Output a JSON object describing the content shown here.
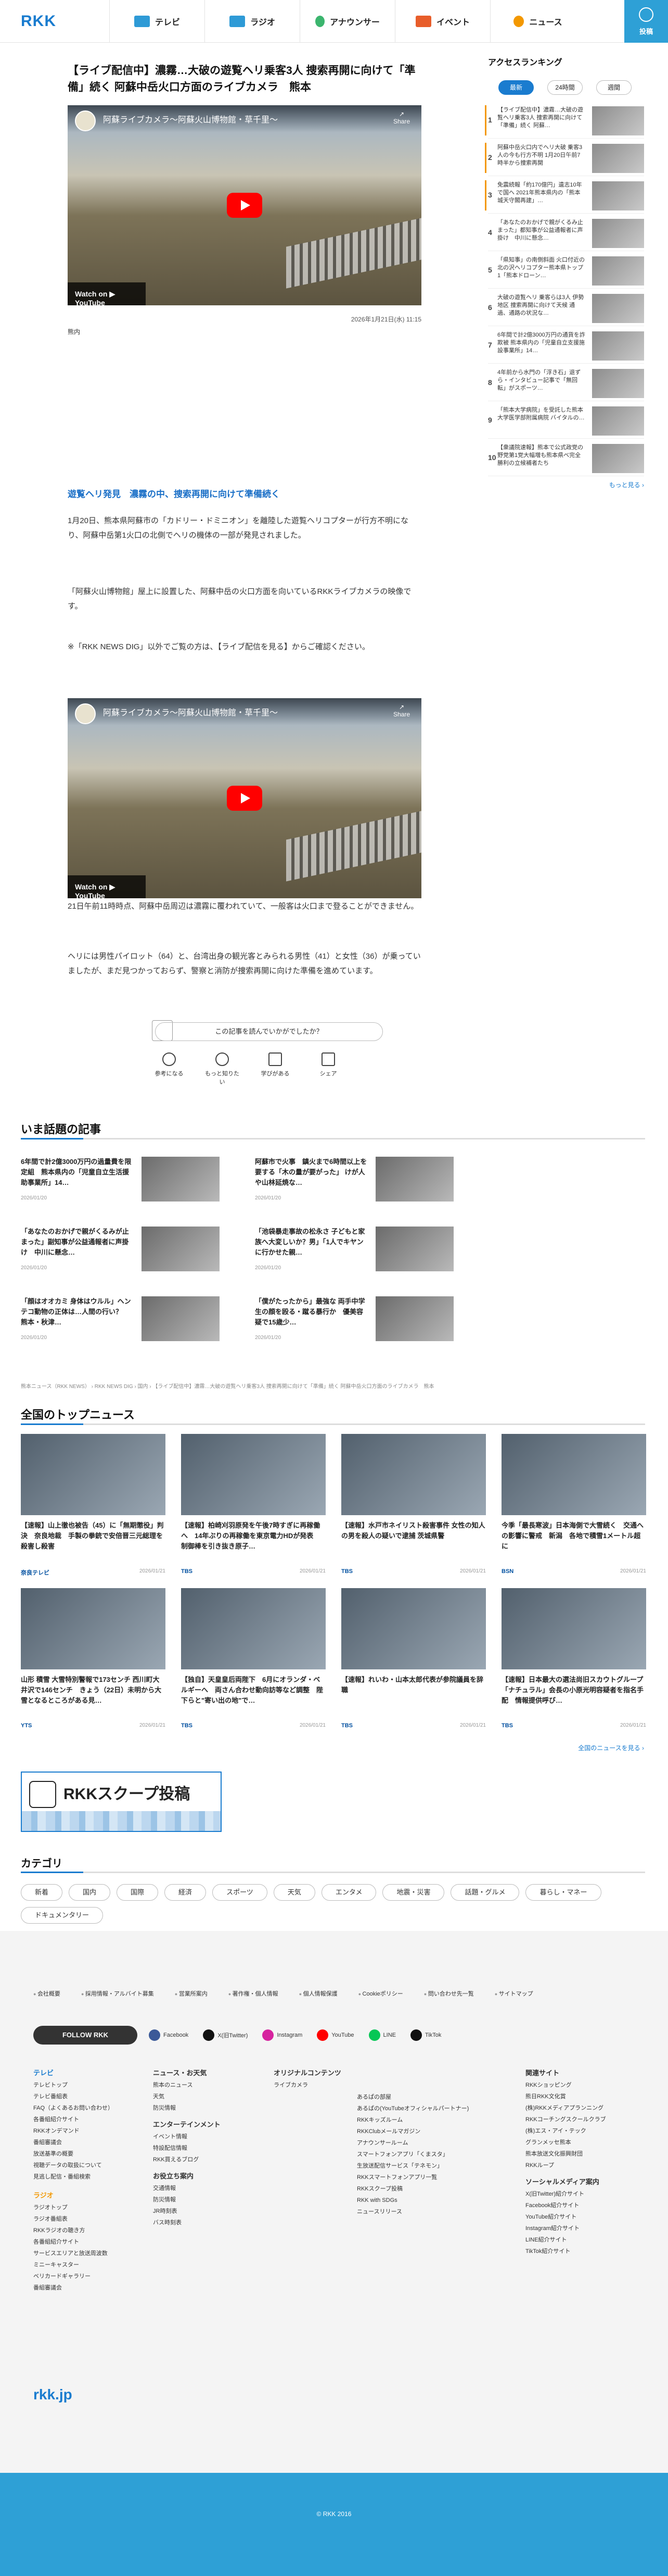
{
  "header": {
    "logo": "RKK",
    "nav": [
      {
        "label": "テレビ",
        "color": "#2e9ad6"
      },
      {
        "label": "ラジオ",
        "color": "#2e9ad6"
      },
      {
        "label": "アナウンサー",
        "color": "#3bb56e"
      },
      {
        "label": "イベント",
        "color": "#e85d2a"
      },
      {
        "label": "ニュース",
        "color": "#f39800"
      }
    ],
    "post": "投稿"
  },
  "article": {
    "title": "【ライブ配信中】濃霧…大破の遊覧ヘリ乗客3人 捜索再開に向けて「準備」続く 阿蘇中岳火口方面のライブカメラ　熊本",
    "video_title": "阿蘇ライブカメラ〜阿蘇火山博物館・草千里〜",
    "share": "Share",
    "watch": "Watch on ▶ YouTube",
    "date": "2026年1月21日(水) 11:15",
    "caption": "熊内",
    "subhead": "遊覧ヘリ発見　濃霧の中、捜索再開に向けて準備続く",
    "p1": "1月20日、熊本県阿蘇市の「カドリー・ドミニオン」を離陸した遊覧ヘリコプターが行方不明になり、阿蘇中岳第1火口の北側でヘリの機体の一部が発見されました。",
    "p2": "「阿蘇火山博物館」屋上に設置した、阿蘇中岳の火口方面を向いているRKKライブカメラの映像です。",
    "p3": "※「RKK NEWS DIG」以外でご覧の方は、【ライブ配信を見る】からご確認ください。",
    "p4": "21日午前11時時点、阿蘇中岳周辺は濃霧に覆われていて、一般客は火口まで登ることができません。",
    "p5": "ヘリには男性パイロット（64）と、台湾出身の観光客とみられる男性（41）と女性（36）が乗っていましたが、まだ見つかっておらず、警察と消防が捜索再開に向けた準備を進めています。",
    "survey": "この記事を読んでいかがでしたか？",
    "reactions": [
      "参考になる",
      "もっと知りたい",
      "学びがある",
      "シェア"
    ]
  },
  "ranking": {
    "title": "アクセスランキング",
    "tabs": [
      "最新",
      "24時間",
      "週間"
    ],
    "items": [
      {
        "n": "1",
        "t": "【ライブ配信中】濃霧…大破の遊覧ヘリ乗客3人 捜索再開に向けて「準備」続く 阿蘇…"
      },
      {
        "n": "2",
        "t": "阿蘇中岳火口内でヘリ大破 乗客3人の今も行方不明 1月20日午前7時半から捜索再開"
      },
      {
        "n": "3",
        "t": "免震続報「約170億円」遺志10年で国へ 2021年熊本県内の「熊本城天守閣再建」…"
      },
      {
        "n": "4",
        "t": "「あなたのおかげで親がくるみ止まった」都知事が公益通報者に声掛け　中川に懸念…"
      },
      {
        "n": "5",
        "t": "「県知事」の南側斜面 火口付近の北の沢ヘリコプター熊本県トップ1「熊本ドローン…"
      },
      {
        "n": "6",
        "t": "大破の遊覧ヘリ 乗客らは3人 伊勢地区 捜索再開に向けて天候 通過、通路の状況な…"
      },
      {
        "n": "7",
        "t": "6年間で計2億3000万円の通貨を詐欺被 熊本県内の「児童自立支援施設事業所」14…"
      },
      {
        "n": "8",
        "t": "4年前から水門の「浮き石」退ずら・インタビュー記事で「無回転」がスポーツ…"
      },
      {
        "n": "9",
        "t": "「熊本大学病院」を受託した熊本大学医学部附属病院 バイタルの…"
      },
      {
        "n": "10",
        "t": "【衆議院速報】熊本で公式政党の野党第1党大幅増も熊本県ベ完全勝利の立候補者たち"
      }
    ],
    "more": "もっと見る ›"
  },
  "topics": {
    "title": "いま話題の記事",
    "items": [
      {
        "t": "6年間で計2億3000万円の過量費を限定組　熊本県内の「児童自立生活援助事業所」14…",
        "d": "2026/01/20"
      },
      {
        "t": "阿蘇市で火事　鎮火まで6時間以上を要する「木の量が要がった」 けが人や山林延焼な…",
        "d": "2026/01/20"
      },
      {
        "t": "「あなたのおかげで親がくるみが止まった」副知事が公益通報者に声掛け　中川に懸念…",
        "d": "2026/01/20"
      },
      {
        "t": "「池袋暴走事故の松永さ 子どもと家族へ大変しいか？男」「1人でキヤンに行かせた親…",
        "d": "2026/01/20"
      },
      {
        "t": "「顔はオオカミ 身体はウルル」ヘンテコ動物の正体は…人間の行い？　熊本・秋津…",
        "d": "2026/01/20"
      },
      {
        "t": "「僕がたったから」最強な 両手中学生の顔を殴る・蹴る暴行か　優美容疑で15歳少…",
        "d": "2026/01/20"
      }
    ]
  },
  "crumb": "熊本ニュース（RKK NEWS） › RKK NEWS DIG › 国内 › 【ライブ配信中】濃霧…大破の遊覧ヘリ乗客3人 捜索再開に向けて「準備」続く 阿蘇中岳火口方面のライブカメラ　熊本",
  "top_news": {
    "title": "全国のトップニュース",
    "more": "全国のニュースを見る ›",
    "items": [
      {
        "t": "【速報】山上徹也被告（45）に「無期懲役」判決　奈良地裁　手製の拳銃で安倍晋三元総理を殺害し殺害",
        "s": "奈良テレビ",
        "tm": "2026/01/21"
      },
      {
        "t": "【速報】柏崎刈羽原発を午後7時すぎに再稼働へ　14年ぶりの再稼働を東京電力HDが発表　制御棒を引き抜き原子…",
        "s": "TBS",
        "tm": "2026/01/21"
      },
      {
        "t": "【速報】水戸市ネイリスト殺害事件 女性の知人の男を殺人の疑いで逮捕 茨城県警",
        "s": "TBS",
        "tm": "2026/01/21"
      },
      {
        "t": "今季「最長寒波」日本海側で大雪続く　交通への影響に警戒　新潟　各地で積雪1メートル超に",
        "s": "BSN",
        "tm": "2026/01/21"
      },
      {
        "t": "山形 積雪 大雪特別警報で173センチ 西川町大井沢で146センチ　きょう（22日）未明から大雪となるところがある見…",
        "s": "YTS",
        "tm": "2026/01/21"
      },
      {
        "t": "【独自】天皇皇后両陛下　6月にオランダ・ベルギーへ　両さん合わせ動向訪等など調整　陛下らと\"寄い出の地\"で…",
        "s": "TBS",
        "tm": "2026/01/21"
      },
      {
        "t": "【速報】れいわ・山本太郎代表が参院議員を辞職",
        "s": "TBS",
        "tm": "2026/01/21"
      },
      {
        "t": "【速報】日本最大の選法尚旧スカウトグループ「ナチュラル」会長の小原光明容疑者を指名手配　情報提供呼び…",
        "s": "TBS",
        "tm": "2026/01/21"
      }
    ]
  },
  "scoop": "RKKスクープ投稿",
  "categories": {
    "title": "カテゴリ",
    "items": [
      "新着",
      "国内",
      "国際",
      "経済",
      "スポーツ",
      "天気",
      "エンタメ",
      "地震・災害",
      "話題・グルメ",
      "暮らし・マネー",
      "ドキュメンタリー"
    ]
  },
  "footer": {
    "links": [
      "会社概要",
      "採用情報・アルバイト募集",
      "営業所案内",
      "著作権・個人情報",
      "個人情報保護",
      "Cookieポリシー",
      "問い合わせ先一覧",
      "サイトマップ"
    ],
    "follow": "FOLLOW RKK",
    "sns": [
      {
        "l": "Facebook",
        "c": "#3b5998"
      },
      {
        "l": "X(旧Twitter)",
        "c": "#111"
      },
      {
        "l": "Instagram",
        "c": "#d6249f"
      },
      {
        "l": "YouTube",
        "c": "#ff0000"
      },
      {
        "l": "LINE",
        "c": "#06c755"
      },
      {
        "l": "TikTok",
        "c": "#111"
      }
    ],
    "col1": {
      "h": "テレビ",
      "items": [
        "テレビトップ",
        "テレビ番組表",
        "FAQ（よくあるお問い合わせ）",
        "各番組紹介サイト",
        "RKKオンデマンド",
        "番組審議会",
        "放送基準の概要",
        "視聴データの取扱について",
        "見逃し配信・番組検索"
      ],
      "h2": "ラジオ",
      "items2": [
        "ラジオトップ",
        "ラジオ番組表",
        "RKKラジオの聴き方",
        "各番組紹介サイト",
        "サービスエリアと放送周波数",
        "ミニーキャスター",
        "ベリカードギャラリー",
        "番組審議会"
      ]
    },
    "col2": {
      "h": "ニュース・お天気",
      "items": [
        "熊本のニュース",
        "天気",
        "防災情報"
      ],
      "h2": "エンターテインメント",
      "items2": [
        "イベント情報",
        "特設配信情報",
        "RKK買えるブログ"
      ],
      "h3": "お役立ち案内",
      "items3": [
        "交通情報",
        "防災情報",
        "JR時刻表",
        "バス時刻表"
      ]
    },
    "col3": {
      "h": "オリジナルコンテンツ",
      "items": [
        "ライブカメラ"
      ]
    },
    "col4": {
      "items": [
        "あるぱの部屋",
        "あるぱの(YouTubeオフィシャルパートナー)",
        "RKKキッズルーム",
        "RKKClubメールマガジン",
        "アナウンサールーム",
        "スマートフォンアプリ「くまスタ」",
        "生放送配信サービス「テネモン」",
        "RKKスマートフォンアプリ一覧",
        "RKKスクープ投稿",
        "RKK with SDGs",
        "ニュースリリース"
      ]
    },
    "col5": {
      "h": "関連サイト",
      "items": [
        "RKKショッピング",
        "熊日RKK文化賞",
        "(株)RKKメディアプランニング",
        "RKKコーチングスクールクラブ",
        "(株)エス・アイ・テック",
        "グランメッセ熊本",
        "熊本放送文化振興財団",
        "RKKループ"
      ],
      "h2": "ソーシャルメディア案内",
      "items2": [
        "X(旧Twitter)紹介サイト",
        "Facebook紹介サイト",
        "YouTube紹介サイト",
        "Instagram紹介サイト",
        "LINE紹介サイト",
        "TikTok紹介サイト"
      ]
    },
    "logo": "rkk.jp",
    "copyright": "© RKK 2016"
  }
}
